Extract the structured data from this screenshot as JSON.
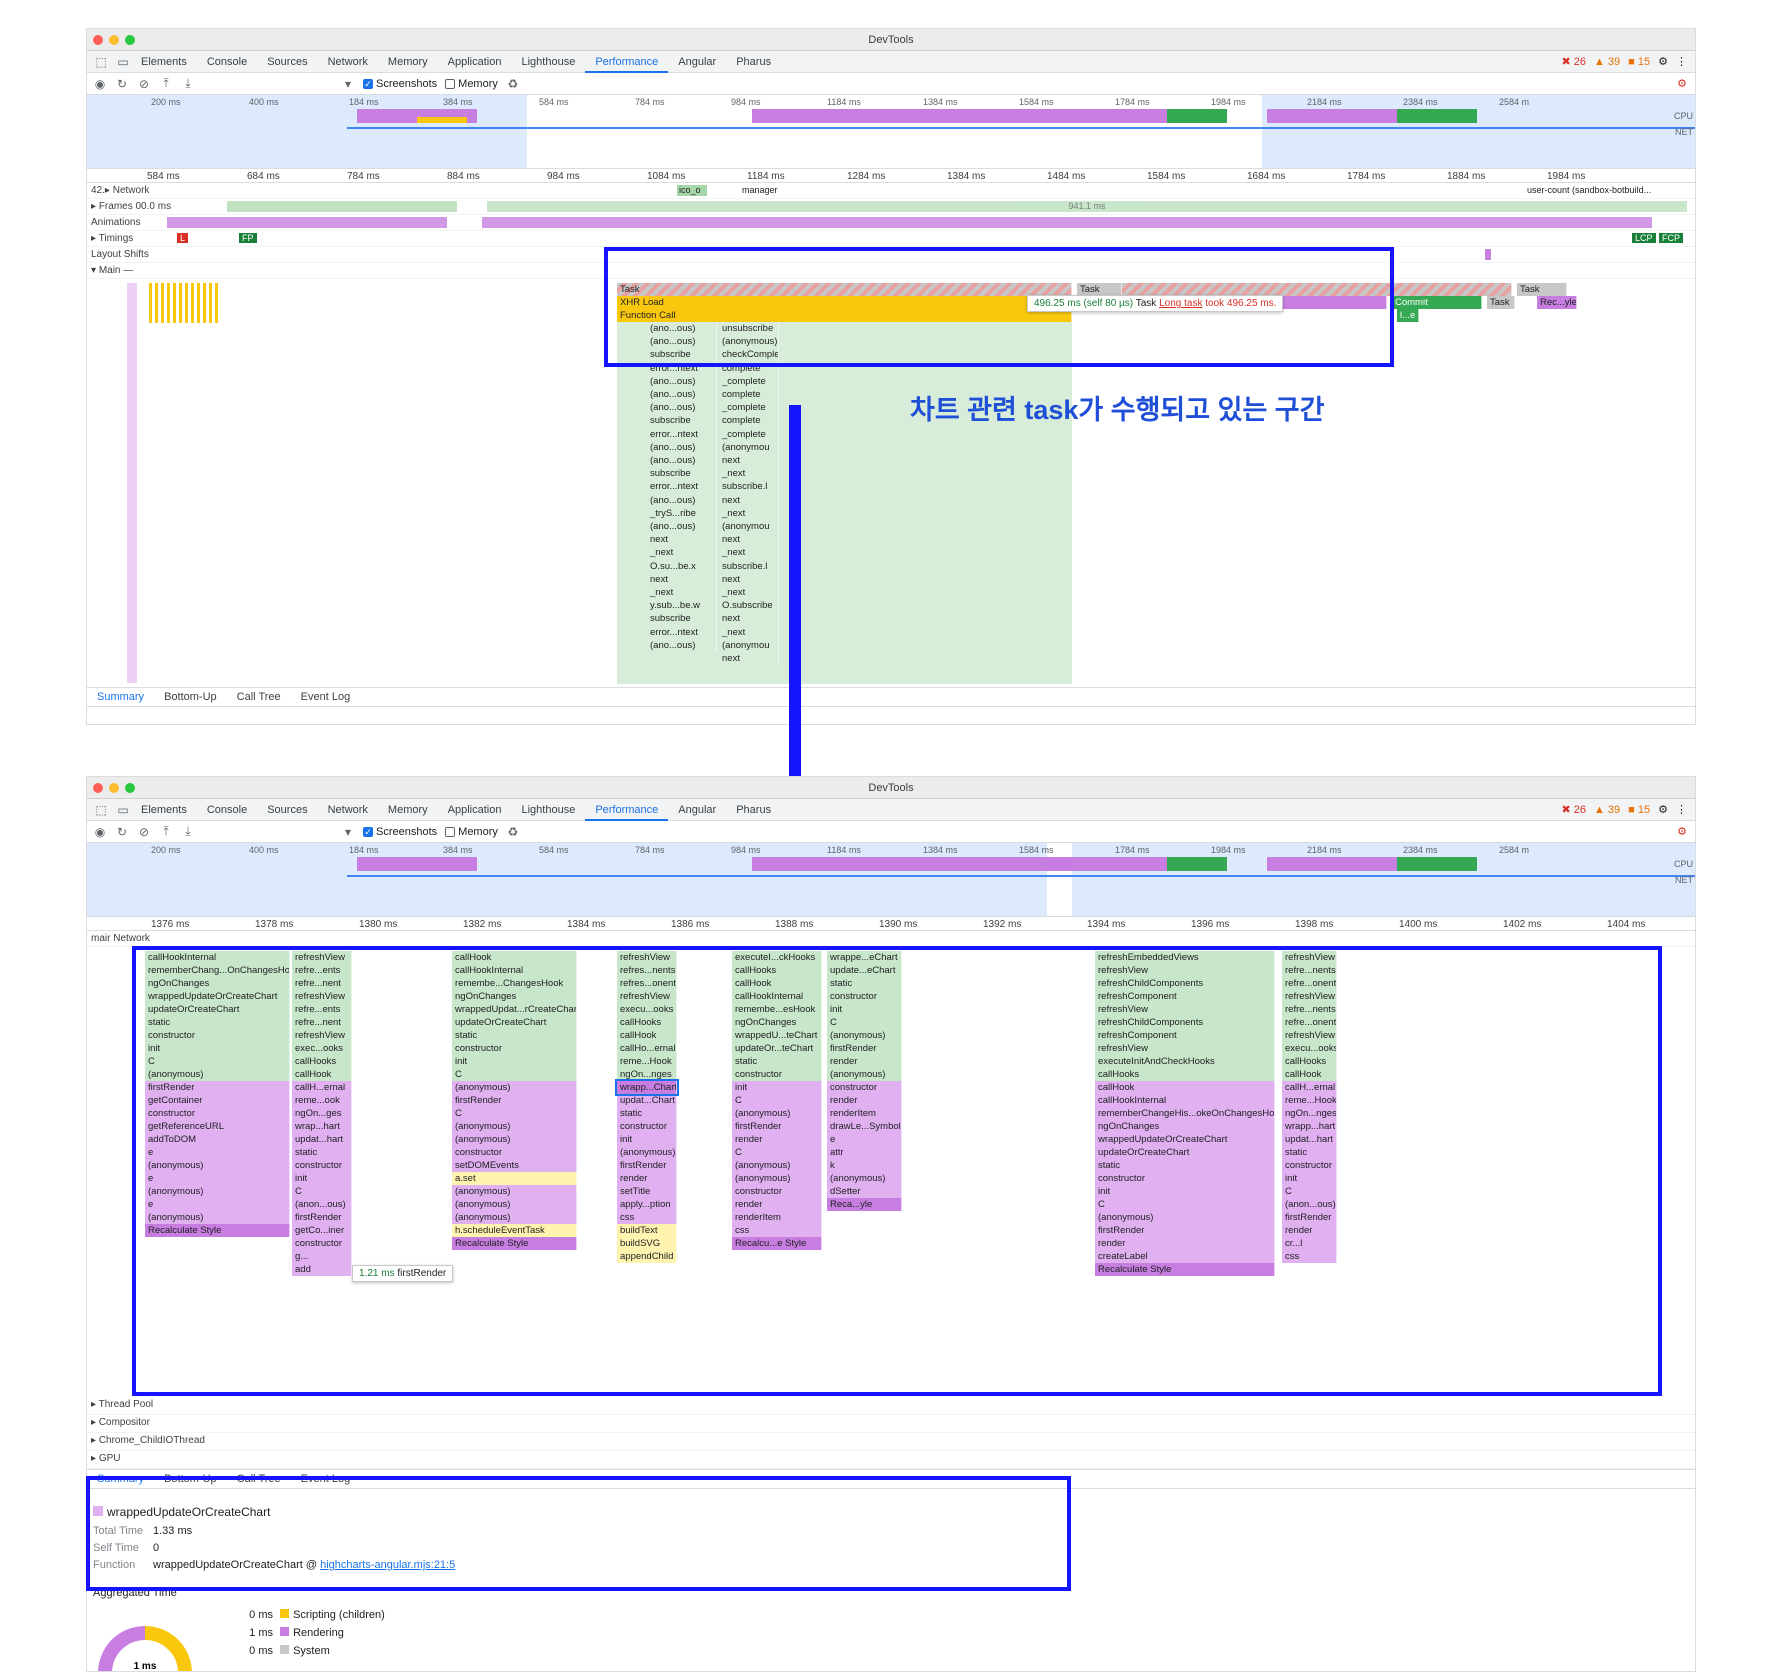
{
  "window_title": "DevTools",
  "tabs": [
    "Elements",
    "Console",
    "Sources",
    "Network",
    "Memory",
    "Application",
    "Lighthouse",
    "Performance",
    "Angular",
    "Pharus"
  ],
  "active_tab": "Performance",
  "status": {
    "errors": "26",
    "warnings": "39",
    "issues": "15"
  },
  "toolbar": {
    "screenshots_label": "Screenshots",
    "memory_label": "Memory",
    "screenshots_checked": true,
    "memory_checked": false
  },
  "overview_ticks": [
    "200 ms",
    "400 ms",
    "184 ms",
    "384 ms",
    "584 ms",
    "784 ms",
    "984 ms",
    "1184 ms",
    "1384 ms",
    "1584 ms",
    "1784 ms",
    "1984 ms",
    "2184 ms",
    "2384 ms",
    "2584 m"
  ],
  "overview_labels": {
    "cpu": "CPU",
    "net": "NET"
  },
  "top": {
    "ruler_ticks": [
      "584 ms",
      "684 ms",
      "784 ms",
      "884 ms",
      "984 ms",
      "1084 ms",
      "1184 ms",
      "1284 ms",
      "1384 ms",
      "1484 ms",
      "1584 ms",
      "1684 ms",
      "1784 ms",
      "1884 ms",
      "1984 ms"
    ],
    "network": {
      "prefix": "42.",
      "label": "Network",
      "items": [
        "ico_o",
        "manager",
        "user-count (sandbox-botbuild..."
      ]
    },
    "frames": {
      "label": "Frames",
      "left_value": "00.0 ms",
      "value": "941.1 ms"
    },
    "animations_label": "Animations",
    "timings": {
      "label": "Timings",
      "marks": [
        "L",
        "FP",
        "LCP",
        "FCP"
      ]
    },
    "layout_shifts_label": "Layout Shifts",
    "main_label": "Main —",
    "flame_top": {
      "task": "Task",
      "xhr": "XHR Load",
      "fcall": "Function Call",
      "task_right_1": "Task",
      "task_right_2": "Task",
      "task_right_3": "Task",
      "commit": "Commit",
      "recalc": "Rec...yle",
      "small": "l...e"
    },
    "tooltip": {
      "time": "496.25 ms (self 80 µs)",
      "name": "Task",
      "long": "Long task",
      "rest": "took 496.25 ms."
    },
    "stack_left": [
      "(ano...ous)",
      "(ano...ous)",
      "subscribe",
      "error...ntext",
      "(ano...ous)",
      "(ano...ous)",
      "(ano...ous)",
      "subscribe",
      "error...ntext",
      "(ano...ous)",
      "(ano...ous)",
      "subscribe",
      "error...ntext",
      "(ano...ous)",
      "_tryS...ribe",
      "(ano...ous)",
      "next",
      "_next",
      "O.su...be.x",
      "next",
      "_next",
      "y.sub...be.w",
      "subscribe",
      "error...ntext",
      "(ano...ous)"
    ],
    "stack_right": [
      "unsubscribe",
      "(anonymous)",
      "checkComplete",
      "complete",
      "_complete",
      "complete",
      "_complete",
      "complete",
      "_complete",
      "(anonymou",
      "next",
      "_next",
      "subscribe.l",
      "next",
      "_next",
      "(anonymou",
      "next",
      "_next",
      "subscribe.l",
      "next",
      "_next",
      "O.subscribe",
      "next",
      "_next",
      "(anonymou",
      "next"
    ],
    "bottom_tabs": [
      "Summary",
      "Bottom-Up",
      "Call Tree",
      "Event Log"
    ]
  },
  "annotation": "차트 관련 task가 수행되고 있는 구간",
  "bottom": {
    "ruler_ticks": [
      "1376 ms",
      "1378 ms",
      "1380 ms",
      "1382 ms",
      "1384 ms",
      "1386 ms",
      "1388 ms",
      "1390 ms",
      "1392 ms",
      "1394 ms",
      "1396 ms",
      "1398 ms",
      "1400 ms",
      "1402 ms",
      "1404 ms"
    ],
    "network_label": "Network",
    "network_prefix": "mair",
    "columns": [
      [
        "callHookInternal",
        "rememberChang...OnChangesHook",
        "ngOnChanges",
        "wrappedUpdateOrCreateChart",
        "updateOrCreateChart",
        "static",
        "constructor",
        "init",
        "C",
        "(anonymous)",
        "firstRender",
        "getContainer",
        "constructor",
        "getReferenceURL",
        "addToDOM",
        "e",
        "(anonymous)",
        "e",
        "(anonymous)",
        "e",
        "(anonymous)",
        "Recalculate Style"
      ],
      [
        "refreshView",
        "refre...ents",
        "refre...nent",
        "refreshView",
        "refre...ents",
        "refre...nent",
        "refreshView",
        "exec...ooks",
        "callHooks",
        "callHook",
        "callH...ernal",
        "reme...ook",
        "ngOn...ges",
        "wrap...hart",
        "updat...hart",
        "static",
        "constructor",
        "init",
        "C",
        "(anon...ous)",
        "firstRender",
        "getCo...iner",
        "constructor",
        "g...",
        "add"
      ],
      [
        "callHook",
        "callHookInternal",
        "remembe...ChangesHook",
        "ngOnChanges",
        "wrappedUpdat...rCreateChart",
        "updateOrCreateChart",
        "static",
        "constructor",
        "init",
        "C",
        "(anonymous)",
        "firstRender",
        "C",
        "(anonymous)",
        "(anonymous)",
        "constructor",
        "setDOMEvents",
        "a.set",
        "(anonymous)",
        "(anonymous)",
        "(anonymous)",
        "h.scheduleEventTask",
        "Recalculate Style"
      ],
      [
        "refreshView",
        "refres...nents",
        "refres...onent",
        "refreshView",
        "execu...ooks",
        "callHooks",
        "callHook",
        "callHo...ernal",
        "reme...Hook",
        "ngOn...nges",
        "wrapp...Chart",
        "updat...Chart",
        "static",
        "constructor",
        "init",
        "(anonymous)",
        "firstRender",
        "render",
        "setTitle",
        "apply...ption",
        "css",
        "buildText",
        "buildSVG",
        "appendChild"
      ],
      [
        "executeI...ckHooks",
        "callHooks",
        "callHook",
        "callHookInternal",
        "remembe...esHook",
        "ngOnChanges",
        "wrappedU...teChart",
        "updateOr...teChart",
        "static",
        "constructor",
        "init",
        "C",
        "(anonymous)",
        "firstRender",
        "render",
        "C",
        "(anonymous)",
        "(anonymous)",
        "constructor",
        "render",
        "renderItem",
        "css",
        "Recalcu...e Style"
      ],
      [
        "wrappe...eChart",
        "update...eChart",
        "static",
        "constructor",
        "init",
        "C",
        "(anonymous)",
        "firstRender",
        "render",
        "(anonymous)",
        "constructor",
        "render",
        "renderItem",
        "drawLe...Symbol",
        "e",
        "attr",
        "k",
        "(anonymous)",
        "dSetter",
        "Reca...yle"
      ],
      [
        "refreshEmbeddedViews",
        "refreshView",
        "refreshChildComponents",
        "refreshComponent",
        "refreshView",
        "refreshChildComponents",
        "refreshComponent",
        "refreshView",
        "executeInitAndCheckHooks",
        "callHooks",
        "callHook",
        "callHookInternal",
        "rememberChangeHis...okeOnChangesHook",
        "ngOnChanges",
        "wrappedUpdateOrCreateChart",
        "updateOrCreateChart",
        "static",
        "constructor",
        "init",
        "C",
        "(anonymous)",
        "firstRender",
        "render",
        "createLabel",
        "Recalculate Style"
      ],
      [
        "refreshView",
        "refre...nents",
        "refre...onent",
        "refreshView",
        "refre...nents",
        "refre...onent",
        "refreshView",
        "execu...ooks",
        "callHooks",
        "callHook",
        "callH...ernal",
        "reme...Hook",
        "ngOn...nges",
        "wrapp...hart",
        "updat...hart",
        "static",
        "constructor",
        "init",
        "C",
        "(anon...ous)",
        "firstRender",
        "render",
        "cr...l",
        "css"
      ]
    ],
    "hover_tooltip": {
      "time": "1.21 ms",
      "name": "firstRender"
    },
    "threads": [
      "Thread Pool",
      "Compositor",
      "Chrome_ChildIOThread",
      "GPU"
    ],
    "bottom_tabs": [
      "Summary",
      "Bottom-Up",
      "Call Tree",
      "Event Log"
    ],
    "summary": {
      "title": "wrappedUpdateOrCreateChart",
      "total_time_label": "Total Time",
      "total_time": "1.33 ms",
      "self_time_label": "Self Time",
      "self_time": "0",
      "function_label": "Function",
      "function_name": "wrappedUpdateOrCreateChart @",
      "function_link": "highcharts-angular.mjs:21:5",
      "aggregated_label": "Aggregated Time",
      "donut_label": "1 ms",
      "legend": [
        {
          "value": "0 ms",
          "label": "Scripting (children)",
          "color": "#f9c80e"
        },
        {
          "value": "1 ms",
          "label": "Rendering",
          "color": "#c77ee0"
        },
        {
          "value": "0 ms",
          "label": "System",
          "color": "#c7c7c7"
        }
      ]
    }
  },
  "colors": {
    "accent": "#1a73e8",
    "annotation_box": "#1414ff",
    "annotation_text": "#1f4fd6"
  }
}
